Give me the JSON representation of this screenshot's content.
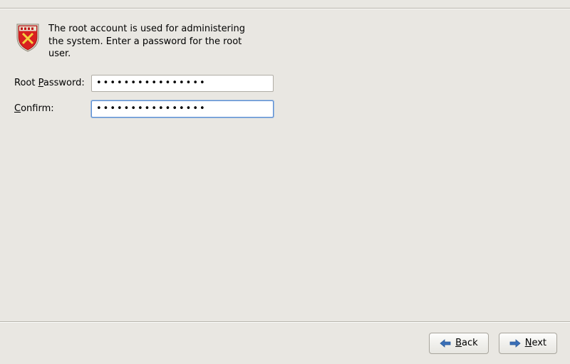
{
  "header": {
    "instruction": "The root account is used for administering the system.  Enter a password for the root user."
  },
  "form": {
    "root_password": {
      "label_pre": "Root ",
      "label_ul": "P",
      "label_post": "assword:",
      "value": "••••••••••••••••"
    },
    "confirm": {
      "label_pre": "",
      "label_ul": "C",
      "label_post": "onfirm:",
      "value": "••••••••••••••••"
    }
  },
  "buttons": {
    "back": {
      "label_ul": "B",
      "label_post": "ack"
    },
    "next": {
      "label_ul": "N",
      "label_post": "ext"
    }
  },
  "icons": {
    "shield": "shield-icon",
    "arrow_left": "arrow-left-icon",
    "arrow_right": "arrow-right-icon"
  }
}
